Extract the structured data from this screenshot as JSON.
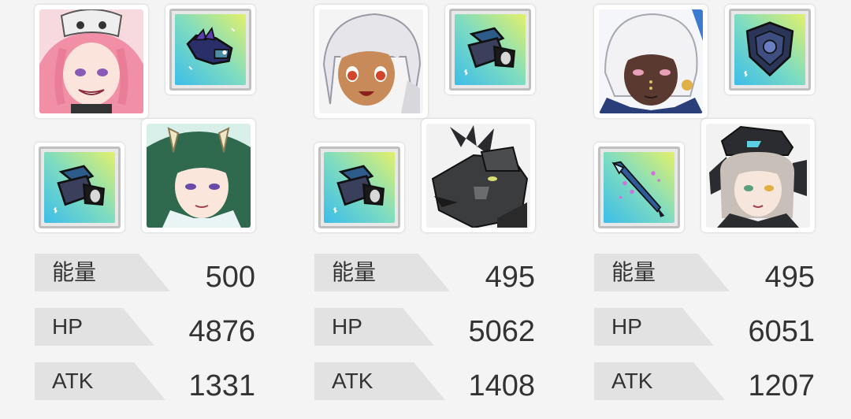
{
  "teams": [
    {
      "characters": [
        {
          "icon": "pink-hair-skull-hat-character-portrait"
        },
        {
          "icon": "green-hair-horned-character-portrait"
        }
      ],
      "items": [
        {
          "icon": "purple-fish-item-icon"
        },
        {
          "icon": "blue-arm-cannon-item-icon"
        }
      ],
      "stats": [
        {
          "label": "能量",
          "value": "500"
        },
        {
          "label": "HP",
          "value": "4876"
        },
        {
          "label": "ATK",
          "value": "1331"
        }
      ]
    },
    {
      "characters": [
        {
          "icon": "white-hair-tan-girl-character-portrait"
        },
        {
          "icon": "black-dragon-character-portrait"
        }
      ],
      "items": [
        {
          "icon": "blue-arm-cannon-item-icon"
        },
        {
          "icon": "blue-arm-cannon-item-icon"
        }
      ],
      "stats": [
        {
          "label": "能量",
          "value": "495"
        },
        {
          "label": "HP",
          "value": "5062"
        },
        {
          "label": "ATK",
          "value": "1408"
        }
      ]
    },
    {
      "characters": [
        {
          "icon": "white-hair-dark-skin-character-portrait"
        },
        {
          "icon": "grey-hair-cat-ear-headset-character-portrait"
        }
      ],
      "items": [
        {
          "icon": "dark-shield-item-icon"
        },
        {
          "icon": "ice-spear-item-icon"
        }
      ],
      "stats": [
        {
          "label": "能量",
          "value": "495"
        },
        {
          "label": "HP",
          "value": "6051"
        },
        {
          "label": "ATK",
          "value": "1207"
        }
      ]
    }
  ],
  "colors": {
    "background": "#f4f4f4",
    "label_tab": "#e2e2e2",
    "text": "#333333",
    "item_gradient_start": "#45c6e8",
    "item_gradient_end": "#d8ef6a"
  }
}
